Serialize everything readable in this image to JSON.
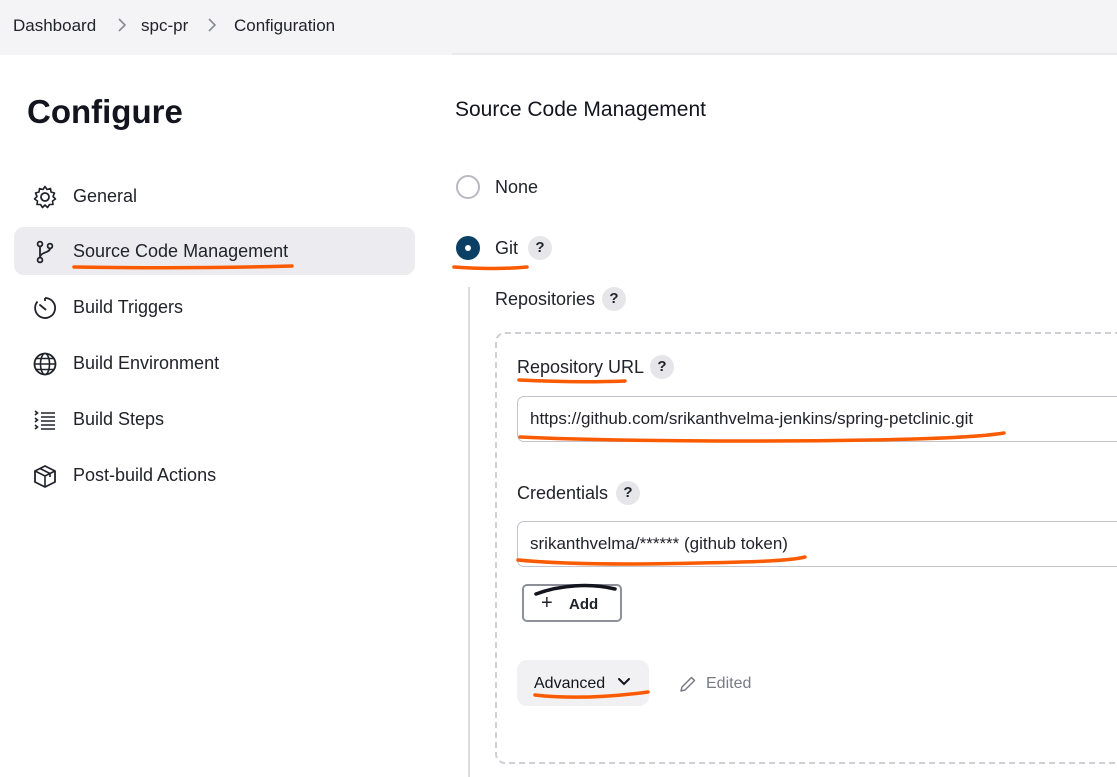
{
  "breadcrumb": {
    "items": [
      "Dashboard",
      "spc-pr",
      "Configuration"
    ]
  },
  "sidebar": {
    "title": "Configure",
    "items": [
      {
        "label": "General",
        "icon": "gear-icon"
      },
      {
        "label": "Source Code Management",
        "icon": "git-branch-icon",
        "active": true
      },
      {
        "label": "Build Triggers",
        "icon": "timer-icon"
      },
      {
        "label": "Build Environment",
        "icon": "globe-icon"
      },
      {
        "label": "Build Steps",
        "icon": "list-icon"
      },
      {
        "label": "Post-build Actions",
        "icon": "box-icon"
      }
    ]
  },
  "main": {
    "section_title": "Source Code Management",
    "options": [
      {
        "label": "None",
        "selected": false
      },
      {
        "label": "Git",
        "selected": true
      }
    ],
    "help_glyph": "?",
    "repositories_label": "Repositories",
    "repository_url_label": "Repository URL",
    "repository_url_value": "https://github.com/srikanthvelma-jenkins/spring-petclinic.git",
    "credentials_label": "Credentials",
    "credentials_value": "srikanthvelma/****** (github token)",
    "add_button_label": "Add",
    "advanced_button_label": "Advanced",
    "edited_label": "Edited"
  },
  "colors": {
    "accent": "#0b3f63",
    "annotation": "#fa5a00",
    "active_nav_bg": "#ececf0"
  }
}
